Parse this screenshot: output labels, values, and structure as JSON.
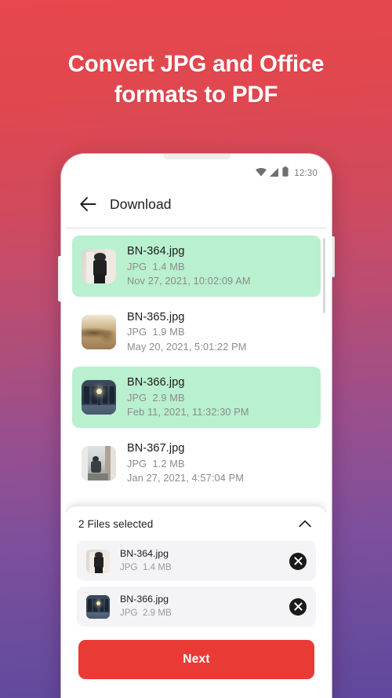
{
  "headline": "Convert JPG and Office formats to PDF",
  "colors": {
    "gradient_top": "#e8474c",
    "gradient_bottom": "#60489c",
    "selected_row": "#b9f0cf",
    "primary_button": "#ea3a36",
    "chip_background": "#f4f4f6"
  },
  "statusbar": {
    "wifi_icon": "wifi-icon",
    "signal_icon": "signal-icon",
    "battery_icon": "battery-icon",
    "time": "12:30"
  },
  "appbar": {
    "back_icon": "back-arrow-icon",
    "title": "Download"
  },
  "files": [
    {
      "name": "BN-364.jpg",
      "type": "JPG",
      "size": "1.4 MB",
      "date": "Nov 27,  2021, 10:02:09 AM",
      "selected": true,
      "thumb": "person-black-shirt-thumb"
    },
    {
      "name": "BN-365.jpg",
      "type": "JPG",
      "size": "1.9 MB",
      "date": "May 20,  2021, 5:01:22 PM",
      "selected": false,
      "thumb": "desert-sand-thumb"
    },
    {
      "name": "BN-366.jpg",
      "type": "JPG",
      "size": "2.9 MB",
      "date": "Feb 11,  2021, 11:32:30 PM",
      "selected": true,
      "thumb": "night-street-lamp-thumb"
    },
    {
      "name": "BN-367.jpg",
      "type": "JPG",
      "size": "1.2 MB",
      "date": "Jan 27,  2021, 4:57:04 PM",
      "selected": false,
      "thumb": "person-window-thumb"
    }
  ],
  "sheet": {
    "title": "2 Files selected",
    "collapse_icon": "chevron-up-icon",
    "selected_files": [
      {
        "name": "BN-364.jpg",
        "type": "JPG",
        "size": "1.4 MB",
        "remove_icon": "close-circle-icon",
        "thumb": "person-black-shirt-thumb"
      },
      {
        "name": "BN-366.jpg",
        "type": "JPG",
        "size": "2.9 MB",
        "remove_icon": "close-circle-icon",
        "thumb": "night-street-lamp-thumb"
      }
    ]
  },
  "next_button": {
    "label": "Next"
  }
}
